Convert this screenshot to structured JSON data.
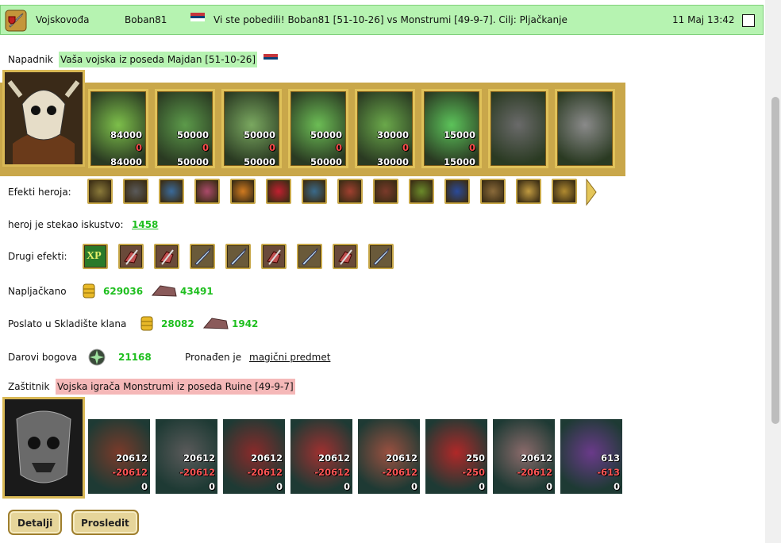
{
  "header": {
    "role": "Vojskovođa",
    "player": "Boban81",
    "message": "Vi ste pobedili! Boban81 [51-10-26] vs Monstrumi [49-9-7]. Cilj: Pljačkanje",
    "date": "11 Maj 13:42"
  },
  "attacker": {
    "label": "Napadnik",
    "army": "Vaša vojska  iz poseda Majdan [51-10-26]",
    "units": [
      {
        "count": "84000",
        "lost": "0",
        "remaining": "84000",
        "color": "#7dbf4a"
      },
      {
        "count": "50000",
        "lost": "0",
        "remaining": "50000",
        "color": "#5c9a4a"
      },
      {
        "count": "50000",
        "lost": "0",
        "remaining": "50000",
        "color": "#7aa860"
      },
      {
        "count": "50000",
        "lost": "0",
        "remaining": "50000",
        "color": "#6cbd55"
      },
      {
        "count": "30000",
        "lost": "0",
        "remaining": "30000",
        "color": "#6aa84a"
      },
      {
        "count": "15000",
        "lost": "0",
        "remaining": "15000",
        "color": "#5cc35a"
      },
      {
        "count": "",
        "lost": "",
        "remaining": "",
        "color": "#6a6a6a"
      },
      {
        "count": "",
        "lost": "",
        "remaining": "",
        "color": "#8a8a8a"
      }
    ]
  },
  "hero_effects": {
    "label": "Efekti heroja:",
    "icons": [
      "chest-icon",
      "cage-icon",
      "gems-icon",
      "rune-icon",
      "fire-chest-icon",
      "heart-icon",
      "shield-icon",
      "helmet-icon",
      "banner-icon",
      "mask-icon",
      "amulet-icon",
      "fence-icon",
      "scroll-icon",
      "staff-icon"
    ]
  },
  "experience": {
    "label": "heroj je stekao iskustvo:",
    "value": "1458"
  },
  "other_effects": {
    "label": "Drugi efekti:",
    "xp": "XP",
    "icons": [
      "xp-icon",
      "fist-icon",
      "fist-icon",
      "sword-icon",
      "sword-icon",
      "fist-icon",
      "sword-icon",
      "fist-icon",
      "sword-icon"
    ]
  },
  "plundered": {
    "label": "Napljačkano",
    "gold": "629036",
    "ore": "43491"
  },
  "clan_storage": {
    "label": "Poslato u Skladište klana",
    "gold": "28082",
    "ore": "1942"
  },
  "gifts": {
    "label": "Darovi bogova",
    "value": "21168",
    "found_label": "Pronađen je",
    "found_item": "magični predmet"
  },
  "defender": {
    "label": "Zaštitnik",
    "army": "Vojska igrača  Monstrumi iz poseda Ruine [49-9-7]",
    "units": [
      {
        "count": "20612",
        "lost": "-20612",
        "remaining": "0",
        "color": "#7a3a2a"
      },
      {
        "count": "20612",
        "lost": "-20612",
        "remaining": "0",
        "color": "#5a5a5a"
      },
      {
        "count": "20612",
        "lost": "-20612",
        "remaining": "0",
        "color": "#8a2a2a"
      },
      {
        "count": "20612",
        "lost": "-20612",
        "remaining": "0",
        "color": "#a03030"
      },
      {
        "count": "20612",
        "lost": "-20612",
        "remaining": "0",
        "color": "#9a5040"
      },
      {
        "count": "250",
        "lost": "-250",
        "remaining": "0",
        "color": "#b02828"
      },
      {
        "count": "20612",
        "lost": "-20612",
        "remaining": "0",
        "color": "#8a6a6a"
      },
      {
        "count": "613",
        "lost": "-613",
        "remaining": "0",
        "color": "#6a3a8a"
      }
    ]
  },
  "buttons": {
    "details": "Detalji",
    "forward": "Prosledit"
  }
}
